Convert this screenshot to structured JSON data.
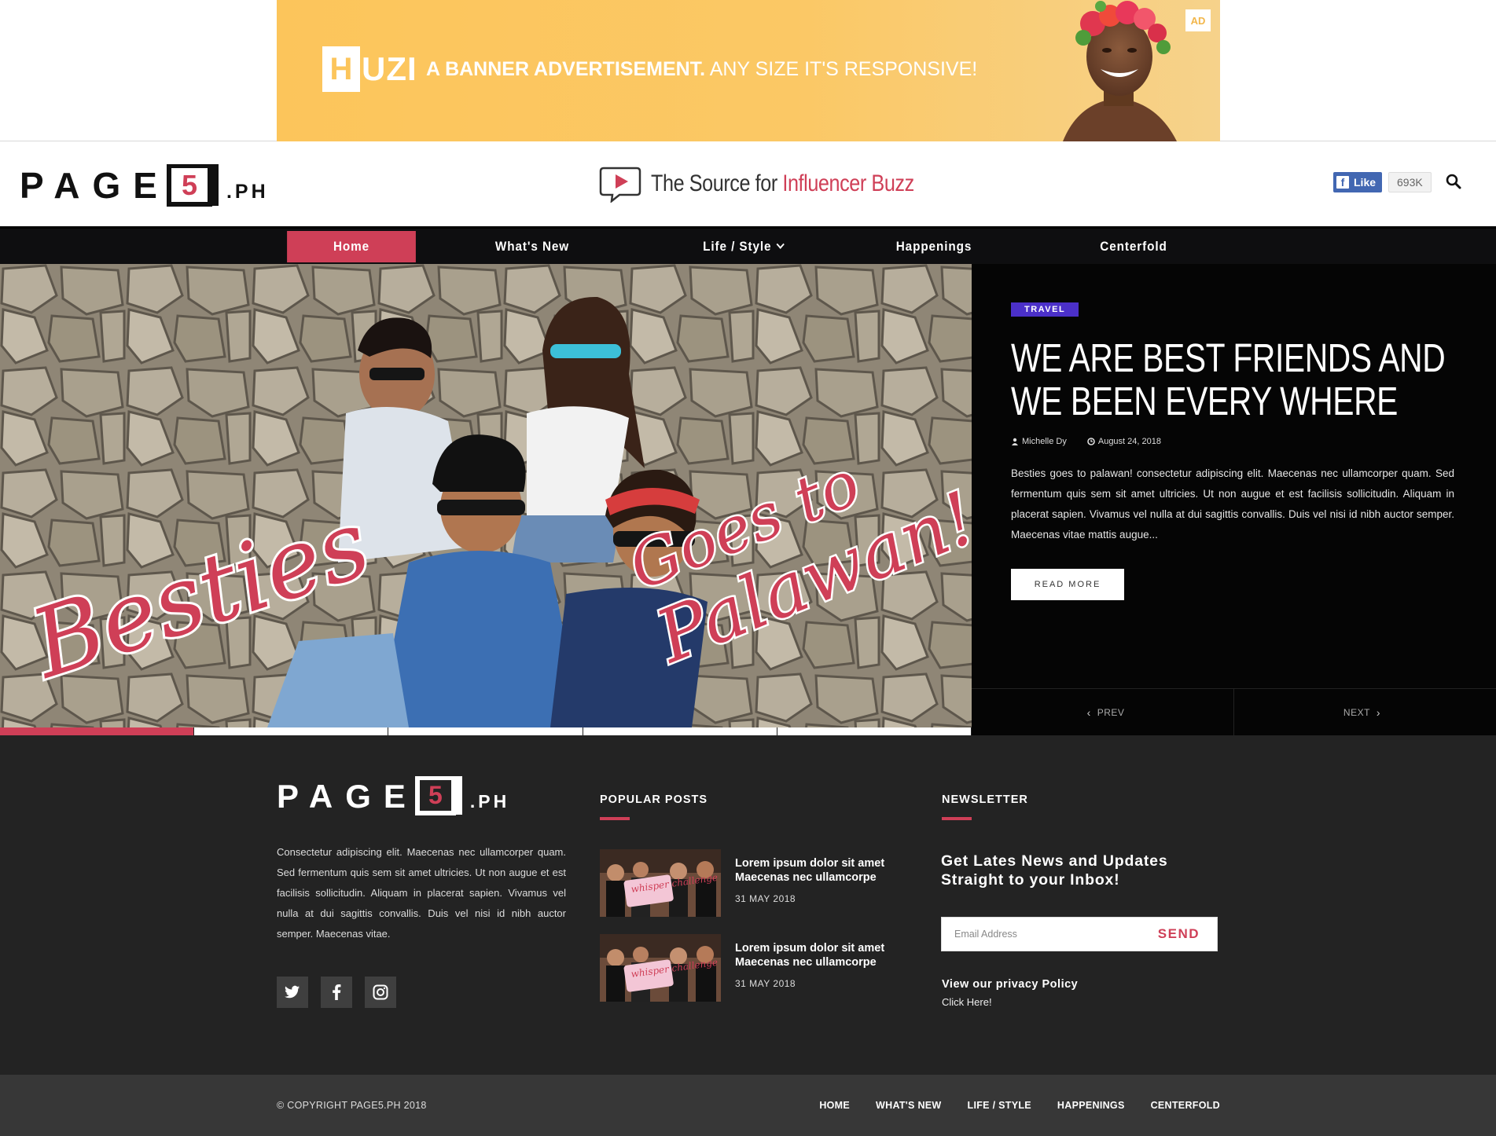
{
  "ad": {
    "logo_letter": "H",
    "logo_rest": "UZI",
    "text_bold": "A BANNER ADVERTISEMENT.",
    "text_rest": "ANY SIZE IT'S RESPONSIVE!",
    "badge": "AD"
  },
  "header": {
    "logo": {
      "letters": "PAGE",
      "number": "5",
      "suffix": ".PH"
    },
    "tagline_prefix": "The Source for ",
    "tagline_accent": "Influencer Buzz",
    "fb_like_label": "Like",
    "fb_count": "693K",
    "search_icon": "search-icon"
  },
  "nav": {
    "items": [
      {
        "label": "Home",
        "active": true
      },
      {
        "label": "What's New"
      },
      {
        "label": "Life / Style",
        "has_dropdown": true
      },
      {
        "label": "Happenings"
      },
      {
        "label": "Centerfold"
      }
    ]
  },
  "hero": {
    "image_text_1": "Goes to",
    "image_text_2": "Palawan!",
    "image_text_3": "Besties",
    "category": "TRAVEL",
    "title": "WE ARE BEST FRIENDS AND WE BEEN EVERY WHERE",
    "author": "Michelle Dy",
    "date": "August 24, 2018",
    "excerpt": "Besties goes to palawan! consectetur adipiscing elit. Maecenas nec ullamcorper quam. Sed fermentum quis sem sit amet ultricies. Ut non augue et est facilisis sollicitudin. Aliquam in placerat sapien. Vivamus vel nulla at dui sagittis convallis. Duis vel nisi id nibh auctor semper. Maecenas vitae mattis augue...",
    "read_more": "READ MORE",
    "prev": "PREV",
    "next": "NEXT",
    "slides_total": 5,
    "slide_active": 1
  },
  "footer": {
    "logo": {
      "letters": "PAGE",
      "number": "5",
      "suffix": ".PH"
    },
    "about": "Consectetur adipiscing elit. Maecenas nec ullamcorper quam. Sed fermentum quis sem sit amet ultricies. Ut non augue et est facilisis sollicitudin. Aliquam in placerat sapien. Vivamus vel nulla at dui sagittis convallis. Duis vel nisi id nibh auctor semper. Maecenas vitae.",
    "social": [
      "twitter-icon",
      "facebook-icon",
      "instagram-icon"
    ],
    "popular_title": "POPULAR POSTS",
    "posts": [
      {
        "title": "Lorem ipsum dolor sit amet Maecenas nec ullamcorpe",
        "date": "31 MAY 2018",
        "thumb_text": "whisper challenge"
      },
      {
        "title": "Lorem ipsum dolor sit amet Maecenas nec ullamcorpe",
        "date": "31 MAY 2018",
        "thumb_text": "whisper challenge"
      }
    ],
    "newsletter_title": "NEWSLETTER",
    "newsletter_heading": "Get Lates News and Updates Straight to your Inbox!",
    "email_placeholder": "Email Address",
    "send": "SEND",
    "privacy_title": "View our privacy Policy",
    "privacy_link": "Click Here!"
  },
  "bottom": {
    "copyright": "© COPYRIGHT PAGE5.PH 2018",
    "links": [
      "HOME",
      "WHAT'S NEW",
      "LIFE / STYLE",
      "HAPPENINGS",
      "CENTERFOLD"
    ]
  },
  "colors": {
    "accent": "#cf3f57",
    "ad_yellow": "#fcc55b",
    "travel_badge": "#4b30c9",
    "footer_bg": "#232323",
    "bottom_bg": "#373737",
    "facebook": "#4267b2"
  }
}
